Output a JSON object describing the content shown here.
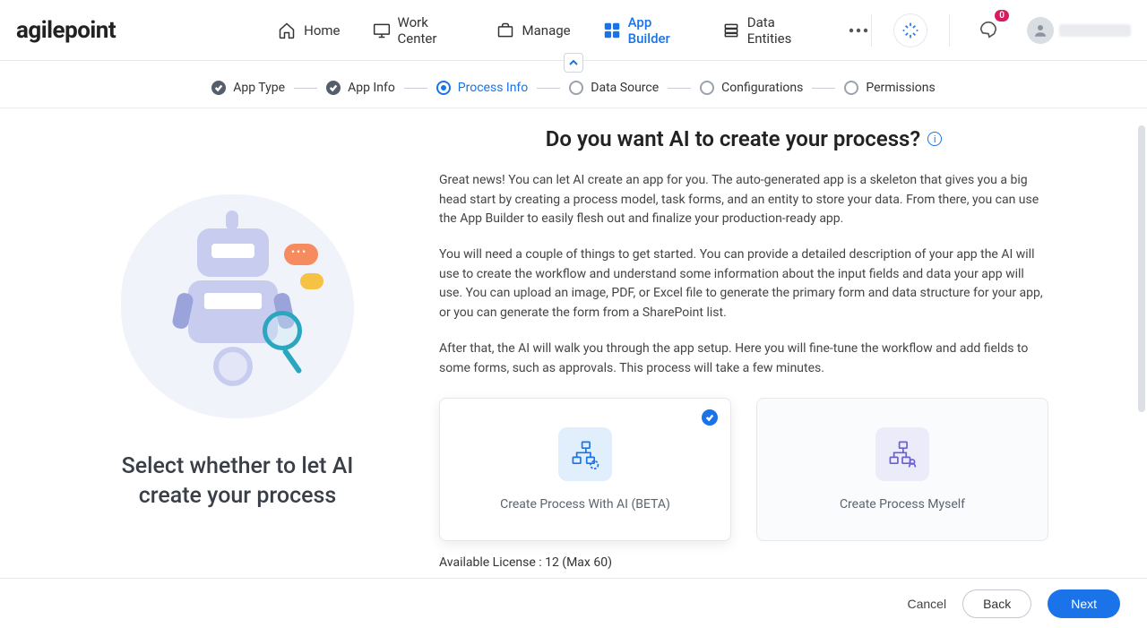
{
  "brand": "agilepoint",
  "nav": {
    "items": [
      {
        "id": "home",
        "label": "Home"
      },
      {
        "id": "workcenter",
        "label": "Work Center"
      },
      {
        "id": "manage",
        "label": "Manage"
      },
      {
        "id": "appbuilder",
        "label": "App Builder"
      },
      {
        "id": "dataentities",
        "label": "Data Entities"
      }
    ]
  },
  "notifications": {
    "count": "0"
  },
  "wizard": {
    "steps": [
      {
        "id": "apptype",
        "label": "App Type",
        "state": "done"
      },
      {
        "id": "appinfo",
        "label": "App Info",
        "state": "done"
      },
      {
        "id": "processinfo",
        "label": "Process Info",
        "state": "active"
      },
      {
        "id": "datasource",
        "label": "Data Source",
        "state": "pending"
      },
      {
        "id": "configurations",
        "label": "Configurations",
        "state": "pending"
      },
      {
        "id": "permissions",
        "label": "Permissions",
        "state": "pending"
      }
    ]
  },
  "left": {
    "heading": "Select whether to let AI create your process"
  },
  "content": {
    "question": "Do you want AI to create your process?",
    "p1": "Great news! You can let AI create an app for you. The auto-generated app is a skeleton that gives you a big head start by creating a process model, task forms, and an entity to store your data. From there, you can use the App Builder to easily flesh out and finalize your production-ready app.",
    "p2": "You will need a couple of things to get started. You can provide a detailed description of your app the AI will use to create the workflow and understand some information about the input fields and data your app will use. You can upload an image, PDF, or Excel file to generate the primary form and data structure for your app, or you can generate the form from a SharePoint list.",
    "p3": "After that, the AI will walk you through the app setup. Here you will fine-tune the workflow and add fields to some forms, such as approvals. This process will take a few minutes."
  },
  "options": {
    "ai": {
      "label": "Create Process With AI (BETA)",
      "selected": true
    },
    "self": {
      "label": "Create Process Myself",
      "selected": false
    }
  },
  "license": {
    "text": "Available License : 12 (Max 60)",
    "available": 12,
    "max": 60
  },
  "footer": {
    "cancel": "Cancel",
    "back": "Back",
    "next": "Next"
  }
}
